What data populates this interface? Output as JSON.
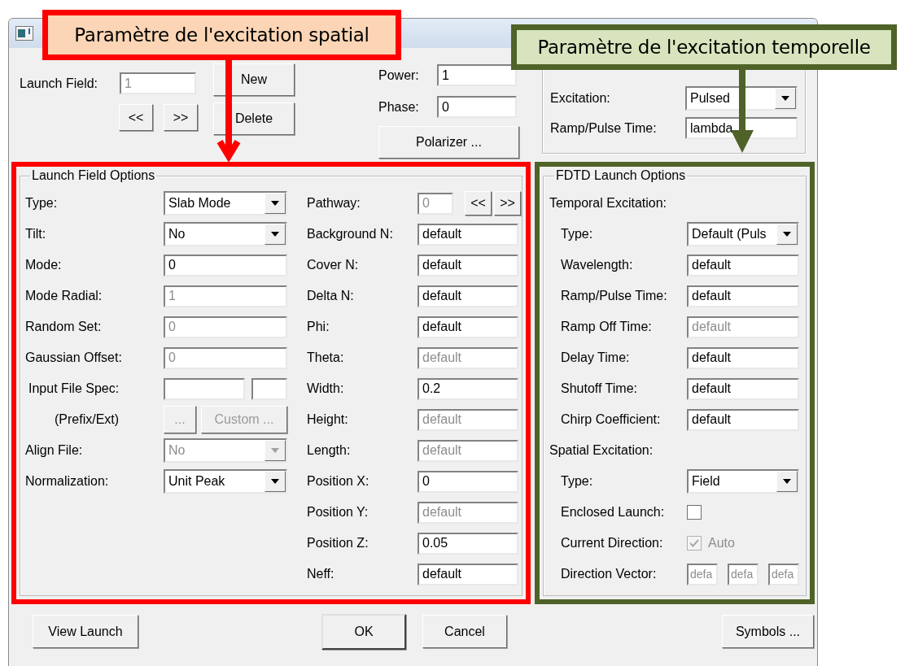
{
  "annotations": [
    {
      "kind": "spatial",
      "text": "Paramètre de l'excitation spatial"
    },
    {
      "kind": "temporal",
      "text": "Paramètre de l'excitation temporelle"
    }
  ],
  "launch_field": {
    "label": "Launch Field:",
    "value": "1",
    "disabled": true
  },
  "nav_buttons": [
    "<<",
    ">>"
  ],
  "record_buttons": [
    "New",
    "Delete"
  ],
  "power": {
    "label": "Power:",
    "value": "1"
  },
  "phase": {
    "label": "Phase:",
    "value": "0"
  },
  "polarizer_button": "Polarizer ...",
  "excitation_group": {
    "rows": [
      {
        "kind": "select",
        "label": "Excitation:",
        "value": "Pulsed",
        "disabled": false
      },
      {
        "kind": "input",
        "label": "Ramp/Pulse Time:",
        "value": "lambda",
        "disabled": false
      }
    ]
  },
  "launch_field_options": {
    "title": "Launch Field Options",
    "left_rows": [
      {
        "kind": "select",
        "label": "Type:",
        "value": "Slab Mode",
        "disabled": false
      },
      {
        "kind": "select",
        "label": "Tilt:",
        "value": "No",
        "disabled": false
      },
      {
        "kind": "input",
        "label": "Mode:",
        "value": "0",
        "disabled": false
      },
      {
        "kind": "input",
        "label": "Mode Radial:",
        "value": "1",
        "disabled": true
      },
      {
        "kind": "input",
        "label": "Random Set:",
        "value": "0",
        "disabled": true
      },
      {
        "kind": "input",
        "label": "Gaussian Offset:",
        "value": "0",
        "disabled": true
      },
      {
        "kind": "file_spec",
        "label": "Input File Spec:"
      },
      {
        "kind": "buttons",
        "label": "(Prefix/Ext)",
        "buttons": [
          {
            "label": "...",
            "disabled": true
          },
          {
            "label": "Custom ...",
            "disabled": true
          }
        ]
      },
      {
        "kind": "select",
        "label": "Align File:",
        "value": "No",
        "disabled": true
      },
      {
        "kind": "select",
        "label": "Normalization:",
        "value": "Unit Peak",
        "disabled": false
      }
    ],
    "right_rows": [
      {
        "kind": "pathway",
        "label": "Pathway:",
        "value": "0",
        "disabled": true,
        "buttons": [
          "<<",
          ">>"
        ]
      },
      {
        "kind": "input",
        "label": "Background N:",
        "value": "default",
        "disabled": false
      },
      {
        "kind": "input",
        "label": "Cover N:",
        "value": "default",
        "disabled": false
      },
      {
        "kind": "input",
        "label": "Delta N:",
        "value": "default",
        "disabled": false
      },
      {
        "kind": "input",
        "label": "Phi:",
        "value": "default",
        "disabled": false
      },
      {
        "kind": "input",
        "label": "Theta:",
        "value": "default",
        "disabled": true
      },
      {
        "kind": "input",
        "label": "Width:",
        "value": "0.2",
        "disabled": false
      },
      {
        "kind": "input",
        "label": "Height:",
        "value": "default",
        "disabled": true
      },
      {
        "kind": "input",
        "label": "Length:",
        "value": "default",
        "disabled": true
      },
      {
        "kind": "input",
        "label": "Position X:",
        "value": "0",
        "disabled": false
      },
      {
        "kind": "input",
        "label": "Position Y:",
        "value": "default",
        "disabled": true
      },
      {
        "kind": "input",
        "label": "Position Z:",
        "value": "0.05",
        "disabled": false
      },
      {
        "kind": "input",
        "label": "Neff:",
        "value": "default",
        "disabled": false
      }
    ]
  },
  "fdtd_launch_options": {
    "title": "FDTD Launch Options",
    "rows": [
      {
        "kind": "heading",
        "label": "Temporal Excitation:"
      },
      {
        "kind": "select",
        "label": "Type:",
        "value": "Default (Puls",
        "disabled": false
      },
      {
        "kind": "input",
        "label": "Wavelength:",
        "value": "default",
        "disabled": false
      },
      {
        "kind": "input",
        "label": "Ramp/Pulse Time:",
        "value": "default",
        "disabled": false
      },
      {
        "kind": "input",
        "label": "Ramp Off Time:",
        "value": "default",
        "disabled": true
      },
      {
        "kind": "input",
        "label": "Delay Time:",
        "value": "default",
        "disabled": false
      },
      {
        "kind": "input",
        "label": "Shutoff Time:",
        "value": "default",
        "disabled": false
      },
      {
        "kind": "input",
        "label": "Chirp Coefficient:",
        "value": "default",
        "disabled": false
      },
      {
        "kind": "heading",
        "label": "Spatial Excitation:"
      },
      {
        "kind": "select",
        "label": "Type:",
        "value": "Field",
        "disabled": false
      },
      {
        "kind": "checkbox",
        "label": "Enclosed Launch:",
        "checked": false,
        "disabled": false
      },
      {
        "kind": "checkbox",
        "label": "Current Direction:",
        "checked": true,
        "disabled": true,
        "text": "Auto"
      },
      {
        "kind": "vector",
        "label": "Direction Vector:",
        "values": [
          "defa",
          "defa",
          "defa"
        ],
        "disabled": true
      }
    ]
  },
  "footer_buttons": [
    {
      "label": "View Launch",
      "default": false
    },
    {
      "label": "OK",
      "default": true
    },
    {
      "label": "Cancel",
      "default": false
    },
    {
      "label": "Symbols ...",
      "default": false
    }
  ]
}
